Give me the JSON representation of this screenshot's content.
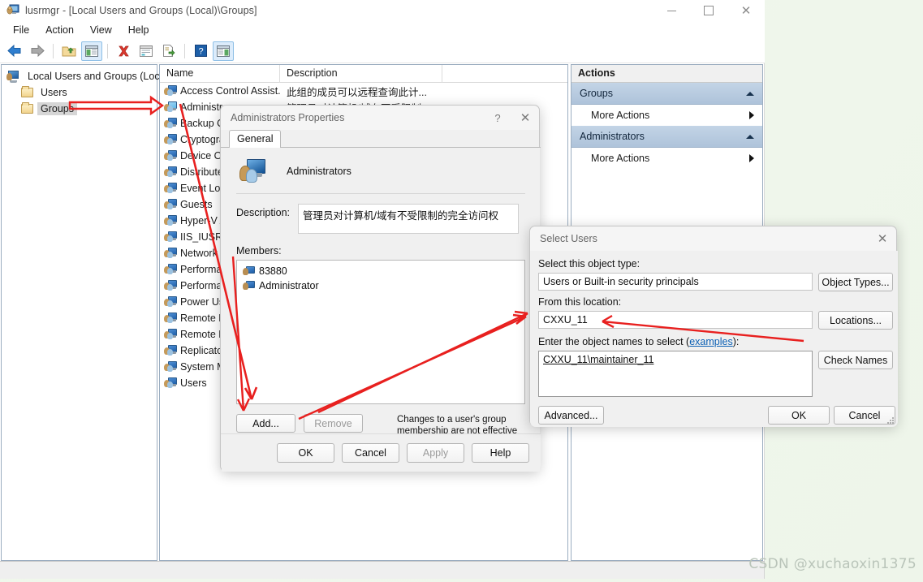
{
  "window": {
    "title": "lusrmgr - [Local Users and Groups (Local)\\Groups]",
    "icon": "computer-users-icon",
    "caption": {
      "minimize": "–",
      "maximize": "□",
      "close": "✕"
    }
  },
  "menubar": {
    "items": [
      "File",
      "Action",
      "View",
      "Help"
    ]
  },
  "toolbar": {
    "buttons": [
      {
        "name": "back-icon",
        "glyph": "←"
      },
      {
        "name": "forward-icon",
        "glyph": "→"
      },
      {
        "name": "up-folder-icon",
        "glyph": "↑"
      },
      {
        "name": "show-hide-tree-icon",
        "glyph": "▤"
      },
      {
        "name": "delete-icon",
        "glyph": "✕"
      },
      {
        "name": "properties-icon",
        "glyph": "▤"
      },
      {
        "name": "export-list-icon",
        "glyph": "☰"
      },
      {
        "name": "help-icon",
        "glyph": "?"
      },
      {
        "name": "show-action-pane-icon",
        "glyph": "▤"
      }
    ]
  },
  "tree": {
    "root": "Local Users and Groups (Local)",
    "items": [
      {
        "label": "Users",
        "selected": false
      },
      {
        "label": "Groups",
        "selected": true
      }
    ]
  },
  "list": {
    "columns": [
      "Name",
      "Description"
    ],
    "rows": [
      {
        "name": "Access Control Assist...",
        "description": "此组的成员可以远程查询此计...",
        "selected": false
      },
      {
        "name": "Administr",
        "description": "管理员对计算机/域有不受限制",
        "selected": true
      },
      {
        "name": "Backup O",
        "description": "",
        "selected": false
      },
      {
        "name": "Cryptogra",
        "description": "",
        "selected": false
      },
      {
        "name": "Device Ow",
        "description": "",
        "selected": false
      },
      {
        "name": "Distribute",
        "description": "",
        "selected": false
      },
      {
        "name": "Event Log",
        "description": "",
        "selected": false
      },
      {
        "name": "Guests",
        "description": "",
        "selected": false
      },
      {
        "name": "Hyper-V A",
        "description": "",
        "selected": false
      },
      {
        "name": "IIS_IUSRS",
        "description": "",
        "selected": false
      },
      {
        "name": "Network ",
        "description": "",
        "selected": false
      },
      {
        "name": "Performa",
        "description": "",
        "selected": false
      },
      {
        "name": "Performa",
        "description": "",
        "selected": false
      },
      {
        "name": "Power Us",
        "description": "",
        "selected": false
      },
      {
        "name": "Remote D",
        "description": "",
        "selected": false
      },
      {
        "name": "Remote N",
        "description": "",
        "selected": false
      },
      {
        "name": "Replicato",
        "description": "",
        "selected": false
      },
      {
        "name": "System M",
        "description": "",
        "selected": false
      },
      {
        "name": "Users",
        "description": "",
        "selected": false
      }
    ]
  },
  "actions": {
    "title": "Actions",
    "sections": [
      {
        "header": "Groups",
        "items": [
          "More Actions"
        ]
      },
      {
        "header": "Administrators",
        "items": [
          "More Actions"
        ]
      }
    ]
  },
  "properties_dialog": {
    "title": "Administrators Properties",
    "help_glyph": "?",
    "close_glyph": "✕",
    "tab": "General",
    "group_name": "Administrators",
    "description_label": "Description:",
    "description_value": "管理员对计算机/域有不受限制的完全访问权",
    "members_label": "Members:",
    "members": [
      "83880",
      "Administrator"
    ],
    "add_button": "Add...",
    "remove_button": "Remove",
    "note": "Changes to a user's group membership are not effective until the next time the user logs on.",
    "footer_buttons": [
      {
        "label": "OK",
        "disabled": false
      },
      {
        "label": "Cancel",
        "disabled": false
      },
      {
        "label": "Apply",
        "disabled": true
      },
      {
        "label": "Help",
        "disabled": false
      }
    ]
  },
  "select_users_dialog": {
    "title": "Select Users",
    "close_glyph": "✕",
    "object_type_label": "Select this object type:",
    "object_type_value": "Users or Built-in security principals",
    "object_types_button": "Object Types...",
    "location_label": "From this location:",
    "location_value": "CXXU_11",
    "locations_button": "Locations...",
    "names_label_prefix": "Enter the object names to select (",
    "names_label_link": "examples",
    "names_label_suffix": "):",
    "names_value": "CXXU_11\\maintainer_11",
    "check_names_button": "Check Names",
    "advanced_button": "Advanced...",
    "ok_button": "OK",
    "cancel_button": "Cancel"
  },
  "watermark": "CSDN @xuchaoxin1375",
  "colors": {
    "accent_blue": "#aec3da",
    "annotation_red": "#e8201f",
    "selection_gray": "#d6d6d6",
    "pane_border": "#9badc0"
  }
}
